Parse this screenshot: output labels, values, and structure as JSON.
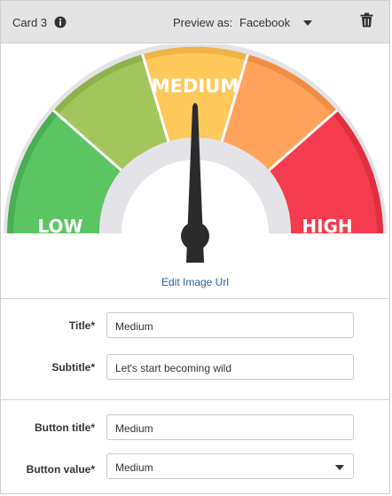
{
  "header": {
    "card_title": "Card 3",
    "preview_label": "Preview as:",
    "preview_value": "Facebook"
  },
  "gauge": {
    "level": "MEDIUM",
    "low_label": "LOW",
    "medium_label": "MEDIUM",
    "high_label": "HIGH"
  },
  "image": {
    "edit_link": "Edit Image Url"
  },
  "form": {
    "title_label": "Title*",
    "title_value": "Medium",
    "subtitle_label": "Subtitle*",
    "subtitle_value": "Let's start becoming wild",
    "button_title_label": "Button title*",
    "button_title_value": "Medium",
    "button_value_label": "Button value*",
    "button_value_value": "Medium"
  },
  "colors": {
    "header_bg": "#e4e4e4",
    "link": "#2b5ea8",
    "gauge_green": "#5cc563",
    "gauge_lightgreen": "#a2c65c",
    "gauge_yellow": "#ffc85a",
    "gauge_orange": "#ffa35c",
    "gauge_red": "#f43c4e"
  }
}
